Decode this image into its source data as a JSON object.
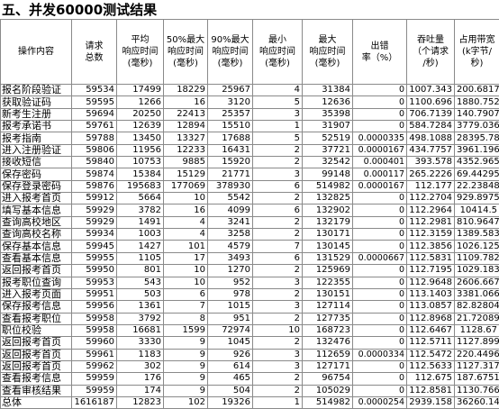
{
  "title": "五、并发60000测试结果",
  "headers": [
    [
      "操作内容"
    ],
    [
      "请求",
      "总数"
    ],
    [
      "平均",
      "响应时间",
      "(毫秒)"
    ],
    [
      "50%最大",
      "响应时间",
      "(毫秒)"
    ],
    [
      "90%最大",
      "响应时间",
      "(毫秒)"
    ],
    [
      "最小",
      "响应时间",
      "(毫秒)"
    ],
    [
      "最大",
      "响应时间",
      "(毫秒)"
    ],
    [
      "出错",
      "率（%）"
    ],
    [
      "吞吐量",
      "（个请求",
      "/秒)"
    ],
    [
      "占用带宽",
      "(k字节/",
      "秒)"
    ]
  ],
  "rows": [
    [
      "报名阶段验证",
      "59534",
      "17499",
      "18229",
      "25967",
      "4",
      "31384",
      "0",
      "1007.343",
      "200.6817"
    ],
    [
      "获取验证码",
      "59595",
      "1266",
      "16",
      "3120",
      "5",
      "12636",
      "0",
      "1100.696",
      "1880.752"
    ],
    [
      "新考生注册",
      "59694",
      "20250",
      "22413",
      "25357",
      "3",
      "35398",
      "0",
      "706.7139",
      "140.7907"
    ],
    [
      "报考承诺书",
      "59761",
      "12639",
      "12894",
      "15510",
      "1",
      "31907",
      "0",
      "584.7284",
      "3779.036"
    ],
    [
      "报考指南",
      "59788",
      "13450",
      "13327",
      "17688",
      "5",
      "52519",
      "0.0000335",
      "498.1088",
      "28395.78"
    ],
    [
      "进入注册验证",
      "59806",
      "11956",
      "12233",
      "16431",
      "2",
      "37721",
      "0.0000167",
      "434.7757",
      "3961.196"
    ],
    [
      "接收短信",
      "59840",
      "10753",
      "9885",
      "15920",
      "2",
      "32542",
      "0.000401",
      "393.578",
      "4352.965"
    ],
    [
      "保存密码",
      "59874",
      "15384",
      "15129",
      "21771",
      "3",
      "99148",
      "0.000117",
      "265.2226",
      "69.44295"
    ],
    [
      "保存登录密码",
      "59876",
      "195683",
      "177069",
      "378930",
      "6",
      "514982",
      "0.0000167",
      "112.177",
      "22.23848"
    ],
    [
      "进入报考首页",
      "59912",
      "5664",
      "10",
      "5542",
      "2",
      "132825",
      "0",
      "112.2704",
      "929.8975"
    ],
    [
      "填写基本信息",
      "59929",
      "3782",
      "16",
      "4099",
      "6",
      "132902",
      "0",
      "112.2964",
      "10414.5"
    ],
    [
      "查询高校地区",
      "59929",
      "1491",
      "4",
      "3241",
      "2",
      "132179",
      "0",
      "112.2981",
      "810.9647"
    ],
    [
      "查询高校名称",
      "59934",
      "1003",
      "4",
      "3258",
      "2",
      "130171",
      "0",
      "112.3159",
      "1389.583"
    ],
    [
      "保存基本信息",
      "59945",
      "1427",
      "101",
      "4579",
      "7",
      "130145",
      "0",
      "112.3856",
      "1026.125"
    ],
    [
      "查看基本信息",
      "59955",
      "1105",
      "17",
      "3493",
      "6",
      "131529",
      "0.0000667",
      "112.5831",
      "1109.782"
    ],
    [
      "返回报考首页",
      "59950",
      "801",
      "10",
      "1270",
      "2",
      "125969",
      "0",
      "112.7195",
      "1029.183"
    ],
    [
      "报考职位查询",
      "59953",
      "543",
      "10",
      "952",
      "3",
      "122355",
      "0",
      "112.9648",
      "2606.667"
    ],
    [
      "进入报考页面",
      "59951",
      "503",
      "6",
      "978",
      "2",
      "130151",
      "0",
      "113.1403",
      "3381.066"
    ],
    [
      "保存报考信息",
      "59956",
      "1361",
      "7",
      "1015",
      "3",
      "127114",
      "0",
      "113.0857",
      "82.82804"
    ],
    [
      "查看报考职位",
      "59958",
      "3792",
      "8",
      "951",
      "2",
      "127735",
      "0",
      "112.8968",
      "21.72089"
    ],
    [
      "职位校验",
      "59958",
      "16681",
      "1599",
      "72974",
      "10",
      "168723",
      "0",
      "112.6467",
      "1128.67"
    ],
    [
      "返回报考首页",
      "59960",
      "3330",
      "9",
      "1045",
      "2",
      "132476",
      "0",
      "112.5711",
      "1127.899"
    ],
    [
      "返回报考首页",
      "59961",
      "1183",
      "9",
      "926",
      "3",
      "112659",
      "0.0000334",
      "112.5472",
      "220.4496"
    ],
    [
      "返回报考首页",
      "59962",
      "302",
      "9",
      "614",
      "3",
      "127171",
      "0",
      "112.5633",
      "1127.317"
    ],
    [
      "查看报考信息",
      "59959",
      "176",
      "9",
      "465",
      "2",
      "96754",
      "0",
      "112.675",
      "187.6751"
    ],
    [
      "查看审核结果",
      "59959",
      "174",
      "9",
      "504",
      "2",
      "105029",
      "0",
      "112.8581",
      "1130.766"
    ],
    [
      "总体",
      "1616187",
      "12823",
      "102",
      "19326",
      "1",
      "514982",
      "0.0000254",
      "2939.158",
      "36260.14"
    ]
  ]
}
